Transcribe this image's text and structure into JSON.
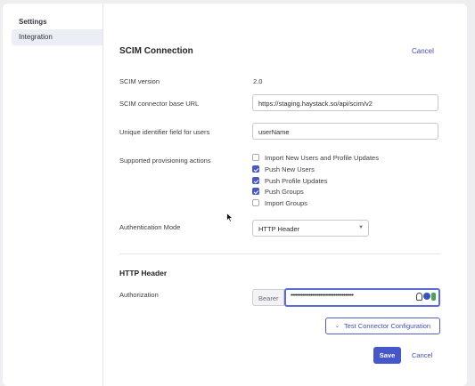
{
  "sidebar": {
    "title": "Settings",
    "items": [
      {
        "label": "Integration"
      }
    ]
  },
  "form": {
    "heading": "SCIM Connection",
    "cancel_label": "Cancel",
    "scim_version": {
      "label": "SCIM version",
      "value": "2.0"
    },
    "base_url": {
      "label": "SCIM connector base URL",
      "value": "https://staging.haystack.so/api/scim/v2"
    },
    "unique_id": {
      "label": "Unique identifier field for users",
      "value": "userName"
    },
    "provisioning": {
      "label": "Supported provisioning actions",
      "options": [
        {
          "label": "Import New Users and Profile Updates",
          "checked": false
        },
        {
          "label": "Push New Users",
          "checked": true
        },
        {
          "label": "Push Profile Updates",
          "checked": true
        },
        {
          "label": "Push Groups",
          "checked": true
        },
        {
          "label": "Import Groups",
          "checked": false
        }
      ]
    },
    "auth_mode": {
      "label": "Authentication Mode",
      "value": "HTTP Header"
    },
    "http_header": {
      "heading": "HTTP Header",
      "authorization_label": "Authorization",
      "prefix": "Bearer",
      "masked_value": "••••••••••••••••••••••••••••••••••••••"
    },
    "test_button": "Test Connector Configuration",
    "save_button": "Save",
    "cancel_bottom": "Cancel"
  },
  "colors": {
    "accent": "#4657c9",
    "link": "#3f4fb8"
  }
}
